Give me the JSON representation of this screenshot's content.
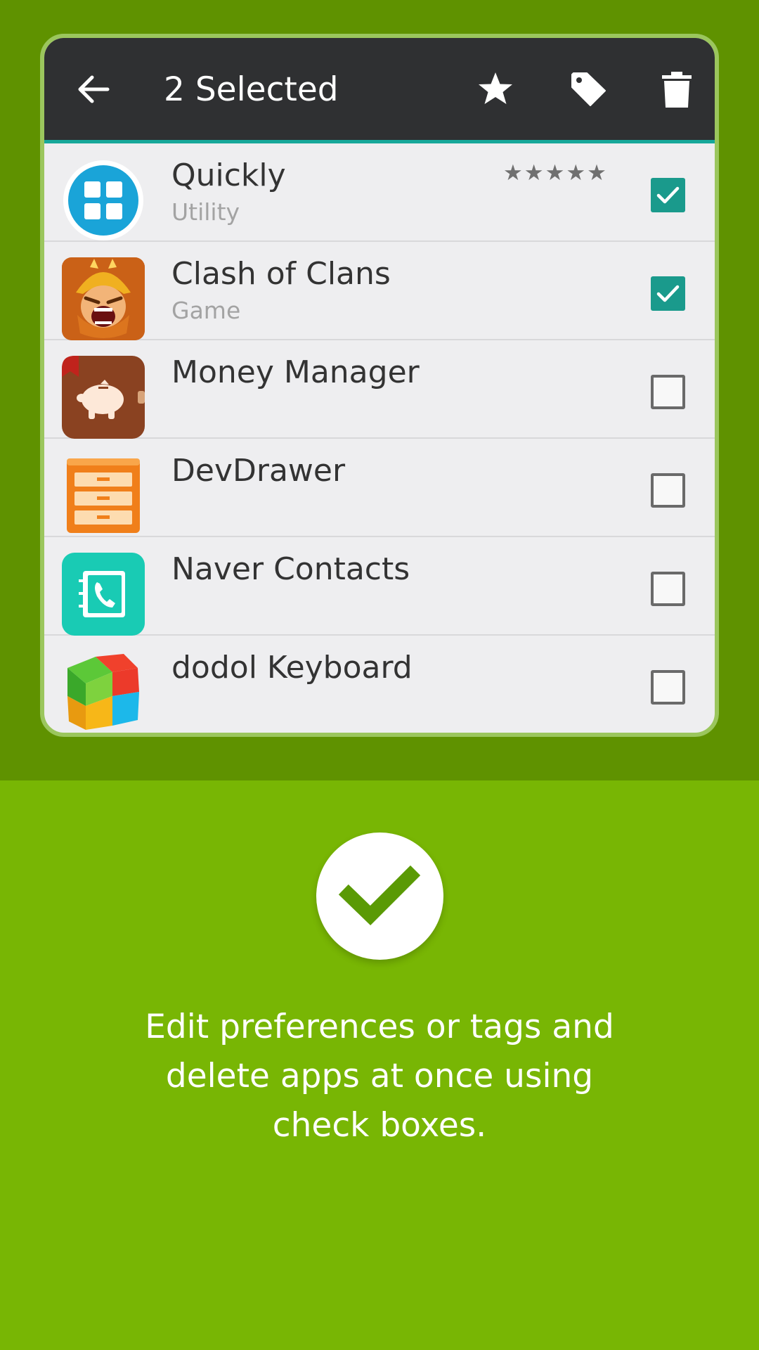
{
  "action_bar": {
    "title": "2 Selected",
    "icons": [
      "back-arrow-icon",
      "star-icon",
      "tag-icon",
      "trash-icon"
    ],
    "accent": "#17a89a"
  },
  "apps": [
    {
      "name": "Quickly",
      "category": "Utility",
      "rating": "★★★★★",
      "checked": true,
      "icon": "quickly-app-icon"
    },
    {
      "name": "Clash of Clans",
      "category": "Game",
      "rating": "",
      "checked": true,
      "icon": "clash-of-clans-app-icon"
    },
    {
      "name": "Money Manager",
      "category": "",
      "rating": "",
      "checked": false,
      "icon": "money-manager-app-icon"
    },
    {
      "name": "DevDrawer",
      "category": "",
      "rating": "",
      "checked": false,
      "icon": "devdrawer-app-icon"
    },
    {
      "name": "Naver Contacts",
      "category": "",
      "rating": "",
      "checked": false,
      "icon": "naver-contacts-app-icon"
    },
    {
      "name": "dodol Keyboard",
      "category": "",
      "rating": "",
      "checked": false,
      "icon": "dodol-keyboard-app-icon"
    }
  ],
  "caption": {
    "line1": "Edit preferences or tags and",
    "line2": "delete apps at once using",
    "line3": "check boxes."
  },
  "colors": {
    "background_top": "#5f9200",
    "background_bottom": "#78b604",
    "checkbox_checked": "#1a9a8c",
    "check_mark": "#5a9a05"
  }
}
